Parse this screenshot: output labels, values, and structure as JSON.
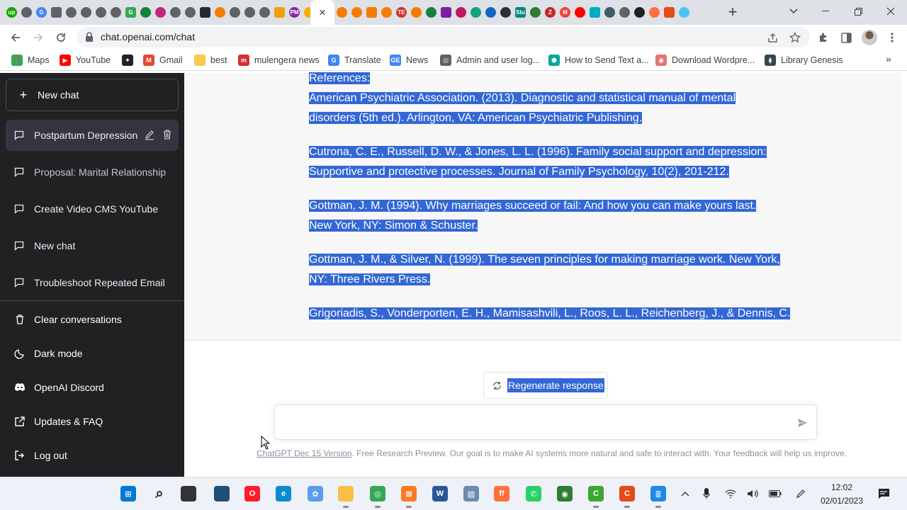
{
  "browser": {
    "url": "chat.openai.com/chat",
    "close_tab": "×",
    "new_tab": "+",
    "tab_favicons": [
      {
        "name": "upwork-icon",
        "color": "#14a800",
        "text": "up"
      },
      {
        "name": "tab-globe-icon",
        "color": "#5f6368",
        "text": ""
      },
      {
        "name": "google-icon",
        "color": "#4285f4",
        "text": "G"
      },
      {
        "name": "tab-globe-icon",
        "color": "#5f6368",
        "text": ""
      },
      {
        "name": "tab-globe-icon",
        "color": "#5f6368",
        "text": ""
      },
      {
        "name": "tab-globe-icon",
        "color": "#5f6368",
        "text": ""
      },
      {
        "name": "tab-globe-icon",
        "color": "#5f6368",
        "text": ""
      },
      {
        "name": "tab-globe-icon",
        "color": "#5f6368",
        "text": ""
      },
      {
        "name": "google-icon",
        "color": "#34a853",
        "text": "G"
      },
      {
        "name": "grammarly-icon",
        "color": "#15803d",
        "text": ""
      },
      {
        "name": "tab-site-icon",
        "color": "#c0267d",
        "text": ""
      },
      {
        "name": "tab-globe-icon",
        "color": "#5f6368",
        "text": ""
      },
      {
        "name": "tab-globe-icon",
        "color": "#5f6368",
        "text": ""
      },
      {
        "name": "github-icon",
        "color": "#24292f",
        "text": ""
      },
      {
        "name": "tab-link-icon",
        "color": "#f57c00",
        "text": ""
      },
      {
        "name": "tab-globe-icon",
        "color": "#5f6368",
        "text": ""
      },
      {
        "name": "tab-globe-icon",
        "color": "#5f6368",
        "text": ""
      },
      {
        "name": "tab-globe-icon",
        "color": "#5f6368",
        "text": ""
      },
      {
        "name": "tab-site-icon",
        "color": "#f59e0b",
        "text": ""
      },
      {
        "name": "tab-site-icon",
        "color": "#8e24aa",
        "text": "PM"
      },
      {
        "name": "analytics-icon",
        "color": "#f9ab00",
        "text": ""
      },
      {
        "name": "tab-link-icon",
        "color": "#f57c00",
        "text": ""
      },
      {
        "name": "tab-link-icon",
        "color": "#f57c00",
        "text": ""
      },
      {
        "name": "tab-link-icon",
        "color": "#f57c00",
        "text": ""
      },
      {
        "name": "tab-link-icon",
        "color": "#f57c00",
        "text": ""
      },
      {
        "name": "tab-site-icon",
        "color": "#d32f2f",
        "text": "TE"
      },
      {
        "name": "tab-cloud-icon",
        "color": "#f57c00",
        "text": ""
      },
      {
        "name": "grammarly-icon",
        "color": "#15803d",
        "text": ""
      },
      {
        "name": "tab-site-icon",
        "color": "#7b1fa2",
        "text": ""
      },
      {
        "name": "tab-site-icon",
        "color": "#c2185b",
        "text": ""
      },
      {
        "name": "openai-icon",
        "color": "#10a37f",
        "text": ""
      },
      {
        "name": "tab-site-icon",
        "color": "#1565c0",
        "text": ""
      },
      {
        "name": "tab-site-icon",
        "color": "#263238",
        "text": ""
      },
      {
        "name": "tab-site-icon",
        "color": "#00897b",
        "text": "Stu"
      },
      {
        "name": "tab-site-icon",
        "color": "#2e7d32",
        "text": ""
      },
      {
        "name": "tab-site-icon",
        "color": "#c62828",
        "text": "Z"
      },
      {
        "name": "gmail-icon",
        "color": "#ea4335",
        "text": "M"
      },
      {
        "name": "youtube-icon",
        "color": "#ff0000",
        "text": ""
      },
      {
        "name": "tab-play-icon",
        "color": "#00acc1",
        "text": ""
      },
      {
        "name": "tab-site-icon",
        "color": "#455a64",
        "text": ""
      },
      {
        "name": "tab-globe-icon",
        "color": "#5f6368",
        "text": ""
      },
      {
        "name": "tab-site-icon",
        "color": "#212121",
        "text": ""
      },
      {
        "name": "tab-site-icon",
        "color": "#ff7043",
        "text": ""
      },
      {
        "name": "tab-site-icon",
        "color": "#e64a19",
        "text": ""
      },
      {
        "name": "tab-loading-icon",
        "color": "#4fc3f7",
        "text": ""
      }
    ]
  },
  "bookmarks": [
    {
      "name": "bookmark-maps",
      "label": "Maps",
      "icon": "maps-icon",
      "color": "#34a853",
      "glyph": "📍"
    },
    {
      "name": "bookmark-youtube",
      "label": "YouTube",
      "icon": "youtube-icon",
      "color": "#ff0000",
      "glyph": "▶"
    },
    {
      "name": "bookmark-unnamed",
      "label": "",
      "icon": "bookmark-site-icon",
      "color": "#222222",
      "glyph": "✦"
    },
    {
      "name": "bookmark-gmail",
      "label": "Gmail",
      "icon": "gmail-icon",
      "color": "#ea4335",
      "glyph": "M"
    },
    {
      "name": "bookmark-best",
      "label": "best",
      "icon": "folder-icon",
      "color": "#f7c948",
      "glyph": ""
    },
    {
      "name": "bookmark-mulengera",
      "label": "mulengera news",
      "icon": "news-site-icon",
      "color": "#d32f2f",
      "glyph": "m"
    },
    {
      "name": "bookmark-translate",
      "label": "Translate",
      "icon": "translate-icon",
      "color": "#4285f4",
      "glyph": "G"
    },
    {
      "name": "bookmark-news",
      "label": "News",
      "icon": "google-news-icon",
      "color": "#4285f4",
      "glyph": "GE"
    },
    {
      "name": "bookmark-admin",
      "label": "Admin and user log...",
      "icon": "globe-icon",
      "color": "#5f6368",
      "glyph": "◎"
    },
    {
      "name": "bookmark-how-to-send",
      "label": "How to Send Text a...",
      "icon": "shield-site-icon",
      "color": "#00a896",
      "glyph": "⬢"
    },
    {
      "name": "bookmark-download-wordpress",
      "label": "Download Wordpre...",
      "icon": "wordpress-site-icon",
      "color": "#e57373",
      "glyph": "◉"
    },
    {
      "name": "bookmark-library-genesis",
      "label": "Library Genesis",
      "icon": "library-icon",
      "color": "#37474f",
      "glyph": "⧫"
    }
  ],
  "bookmarks_more": "»",
  "sidebar": {
    "new_chat": "New chat",
    "conversations": [
      {
        "label": "Postpartum Depression",
        "active": true
      },
      {
        "label": "Proposal: Marital Relationship,",
        "active": false
      },
      {
        "label": "Create Video CMS YouTube",
        "active": false
      },
      {
        "label": "New chat",
        "active": false
      },
      {
        "label": "Troubleshoot Repeated Email",
        "active": false
      }
    ],
    "menu": {
      "clear": "Clear conversations",
      "dark": "Dark mode",
      "discord": "OpenAI Discord",
      "faq": "Updates & FAQ",
      "logout": "Log out"
    }
  },
  "chat": {
    "references_heading": "References:",
    "references": [
      {
        "line1": "American Psychiatric Association. (2013). Diagnostic and statistical manual of mental",
        "line2": "disorders (5th ed.). Arlington, VA: American Psychiatric Publishing."
      },
      {
        "line1": "Cutrona, C. E., Russell, D. W., & Jones, L. L. (1996). Family social support and depression:",
        "line2": "Supportive and protective processes. Journal of Family Psychology, 10(2), 201-212."
      },
      {
        "line1": "Gottman, J. M. (1994). Why marriages succeed or fail: And how you can make yours last.",
        "line2": "New York, NY: Simon & Schuster."
      },
      {
        "line1": "Gottman, J. M., & Silver, N. (1999). The seven principles for making marriage work. New York,",
        "line2": "NY: Three Rivers Press."
      },
      {
        "line1": "Grigoriadis, S., Vonderporten, E. H., Mamisashvili, L., Roos, L. L., Reichenberg, J., & Dennis, C.",
        "line2": ""
      }
    ],
    "regenerate": "Regenerate response",
    "input_value": "",
    "footer_link": "ChatGPT Dec 15 Version",
    "footer_text": ". Free Research Preview. Our goal is to make AI systems more natural and safe to interact with. Your feedback will help us improve.",
    "highlight_color": "#3367d6"
  },
  "taskbar": {
    "time": "12:02",
    "date": "02/01/2023",
    "apps": [
      {
        "name": "start-icon",
        "color": "#0078d4",
        "text": "⊞"
      },
      {
        "name": "search-icon",
        "color": "transparent",
        "text": "⌕"
      },
      {
        "name": "task-view-icon",
        "color": "#333333",
        "text": ""
      },
      {
        "name": "widgets-icon",
        "color": "#1f4e79",
        "text": ""
      },
      {
        "name": "opera-icon",
        "color": "#ff1b2d",
        "text": "O"
      },
      {
        "name": "edge-icon",
        "color": "#0c8ad1",
        "text": "e"
      },
      {
        "name": "app-icon",
        "color": "#5c9ded",
        "text": "✿"
      },
      {
        "name": "file-explorer-icon",
        "color": "#f8c146",
        "text": ""
      },
      {
        "name": "chrome-icon",
        "color": "#34a853",
        "text": "◎"
      },
      {
        "name": "xampp-icon",
        "color": "#fb7a24",
        "text": "⊠"
      },
      {
        "name": "word-icon",
        "color": "#2b579a",
        "text": "W"
      },
      {
        "name": "photos-icon",
        "color": "#6a8caf",
        "text": "▨"
      },
      {
        "name": "firefox-icon",
        "color": "#ff7139",
        "text": "ff"
      },
      {
        "name": "whatsapp-icon",
        "color": "#25d366",
        "text": "✆"
      },
      {
        "name": "network-app-icon",
        "color": "#2e7d32",
        "text": "◉"
      },
      {
        "name": "camtasia-icon",
        "color": "#3fa535",
        "text": "C"
      },
      {
        "name": "camtasia-red-icon",
        "color": "#e64a19",
        "text": "C"
      },
      {
        "name": "notepad-icon",
        "color": "#1e88e5",
        "text": "≣"
      }
    ]
  }
}
